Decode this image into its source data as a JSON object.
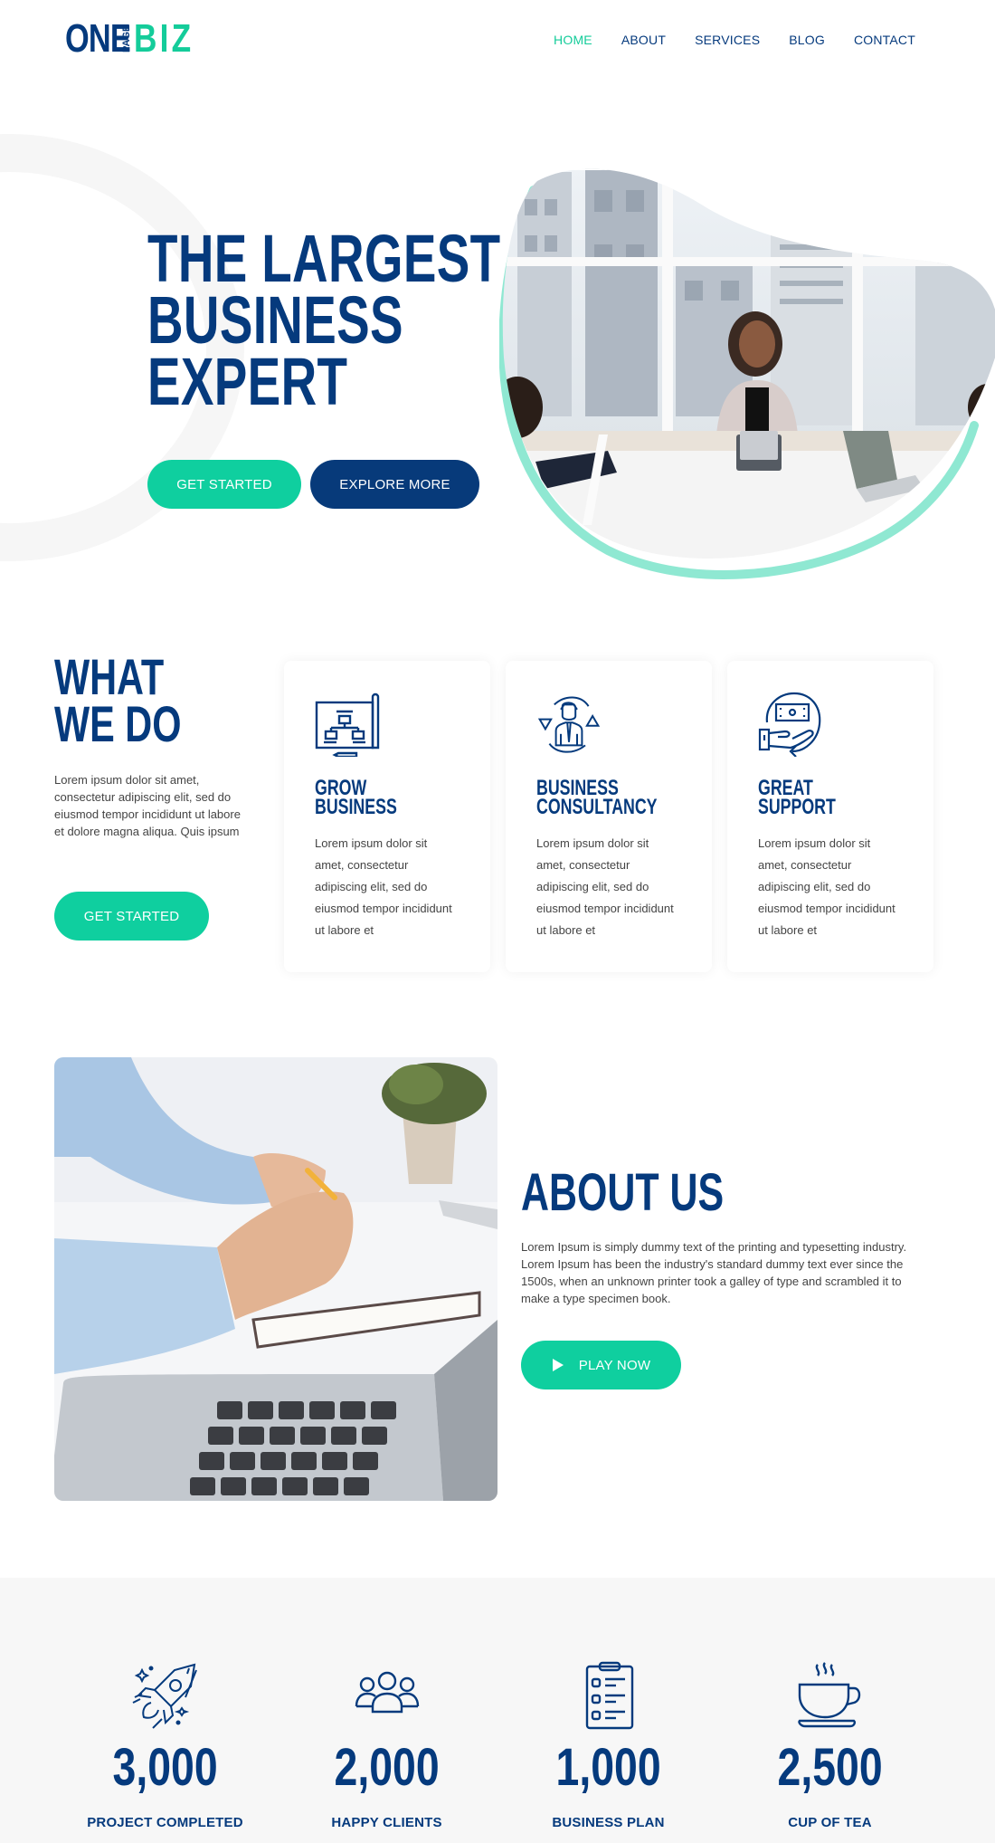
{
  "brand": {
    "part1": "ONE",
    "part2": "PAGE",
    "part3": "BIZ"
  },
  "colors": {
    "navy": "#053a7d",
    "green": "#0fcf9f",
    "text": "#444444",
    "stats_bg": "#f7f7f7"
  },
  "nav": {
    "items": [
      {
        "label": "HOME",
        "active": true
      },
      {
        "label": "ABOUT"
      },
      {
        "label": "SERVICES"
      },
      {
        "label": "BLOG"
      },
      {
        "label": "CONTACT"
      }
    ]
  },
  "hero": {
    "title_lines": [
      "THE LARGEST",
      "BUSINESS",
      "EXPERT"
    ],
    "primary_button": "GET STARTED",
    "secondary_button": "EXPLORE MORE",
    "image_alt": "team-meeting-photo"
  },
  "what_we_do": {
    "title_lines": [
      "WHAT",
      "WE DO"
    ],
    "text": "Lorem ipsum dolor sit amet, consectetur adipiscing elit, sed do eiusmod tempor incididunt ut labore et dolore magna aliqua. Quis ipsum",
    "button": "GET STARTED",
    "cards": [
      {
        "icon": "blueprint-icon",
        "title_lines": [
          "GROW",
          "BUSINESS"
        ],
        "text": "Lorem ipsum dolor sit amet, consectetur adipiscing elit, sed do eiusmod tempor incididunt ut labore et"
      },
      {
        "icon": "consultant-icon",
        "title_lines": [
          "BUSINESS",
          "CONSULTANCY"
        ],
        "text": "Lorem ipsum dolor sit amet, consectetur adipiscing elit, sed do eiusmod tempor incididunt ut labore et"
      },
      {
        "icon": "money-hand-icon",
        "title_lines": [
          "GREAT",
          "SUPPORT"
        ],
        "text": "Lorem ipsum dolor sit amet, consectetur adipiscing elit, sed do eiusmod tempor incididunt ut labore et"
      }
    ]
  },
  "about": {
    "title": "ABOUT US",
    "text": "Lorem Ipsum is simply dummy text of the printing and typesetting industry. Lorem Ipsum has been the industry's standard dummy text ever since the 1500s, when an unknown printer took a galley of type and scrambled it to make a type specimen book.",
    "button": "PLAY NOW",
    "image_alt": "desk-laptop-photo"
  },
  "stats": [
    {
      "icon": "rocket-icon",
      "value": "3,000",
      "label": "PROJECT COMPLETED"
    },
    {
      "icon": "users-icon",
      "value": "2,000",
      "label": "HAPPY CLIENTS"
    },
    {
      "icon": "clipboard-icon",
      "value": "1,000",
      "label": "BUSINESS PLAN"
    },
    {
      "icon": "tea-cup-icon",
      "value": "2,500",
      "label": "CUP OF TEA"
    }
  ]
}
